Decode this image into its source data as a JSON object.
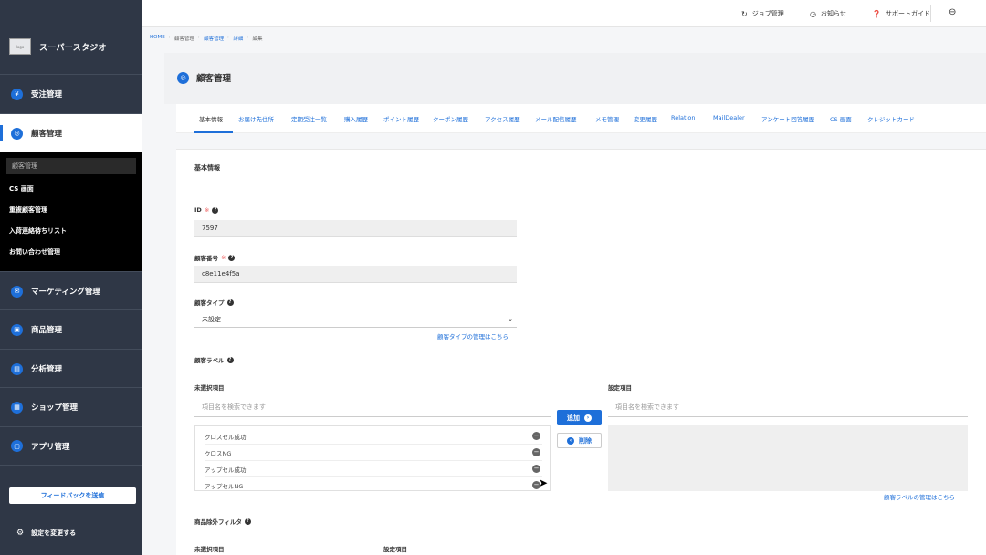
{
  "sidebar": {
    "brand_logo_text": "logo",
    "brand_name": "スーパースタジオ",
    "nav": [
      {
        "label": "受注管理",
        "icon": "cart-icon",
        "glyph": "🛒"
      },
      {
        "label": "顧客管理",
        "icon": "customer-icon",
        "glyph": "◎"
      },
      {
        "label": "マーケティング管理",
        "icon": "mail-icon",
        "glyph": "✉"
      },
      {
        "label": "商品管理",
        "icon": "box-icon",
        "glyph": "▣"
      },
      {
        "label": "分析管理",
        "icon": "chart-icon",
        "glyph": "▤"
      },
      {
        "label": "ショップ管理",
        "icon": "shop-icon",
        "glyph": "▦"
      },
      {
        "label": "アプリ管理",
        "icon": "app-icon",
        "glyph": "▢"
      }
    ],
    "submenu": [
      "顧客管理",
      "CS 画面",
      "重複顧客管理",
      "入荷連絡待ちリスト",
      "お問い合わせ管理"
    ],
    "feedback_label": "フィードバックを送信",
    "settings_label": "設定を変更する"
  },
  "topbar": {
    "job": "ジョブ管理",
    "notice": "お知らせ",
    "support": "サポートガイド"
  },
  "breadcrumb": [
    "HOME",
    "顧客管理",
    "顧客管理",
    "詳細",
    "編集"
  ],
  "page_title": "顧客管理",
  "tabs": [
    "基本情報",
    "お届け先住所",
    "定期受注一覧",
    "購入履歴",
    "ポイント履歴",
    "クーポン履歴",
    "アクセス履歴",
    "メール配信履歴",
    "メモ管理",
    "変更履歴",
    "Relation",
    "MailDealer",
    "アンケート回答履歴",
    "CS 画面",
    "クレジットカード"
  ],
  "form": {
    "section_title": "基本情報",
    "id_label": "ID",
    "id_value": "7597",
    "customer_no_label": "顧客番号",
    "customer_no_value": "c8e11e4f5a",
    "required_mark": "※",
    "type_label": "顧客タイプ",
    "type_value": "未設定",
    "type_manage_link": "顧客タイプの管理はこちら",
    "label_label": "顧客ラベル",
    "unselected_label": "未選択項目",
    "selected_label": "設定項目",
    "search_placeholder": "項目名を検索できます",
    "unselected_items": [
      "クロスセル成功",
      "クロスNG",
      "アップセル成功",
      "アップセルNG"
    ],
    "add_button": "追加",
    "delete_button": "削除",
    "label_manage_link": "顧客ラベルの管理はこちら",
    "filter_label": "商品除外フィルタ",
    "filter_unselected_label": "未選択項目",
    "filter_selected_label": "設定項目"
  }
}
